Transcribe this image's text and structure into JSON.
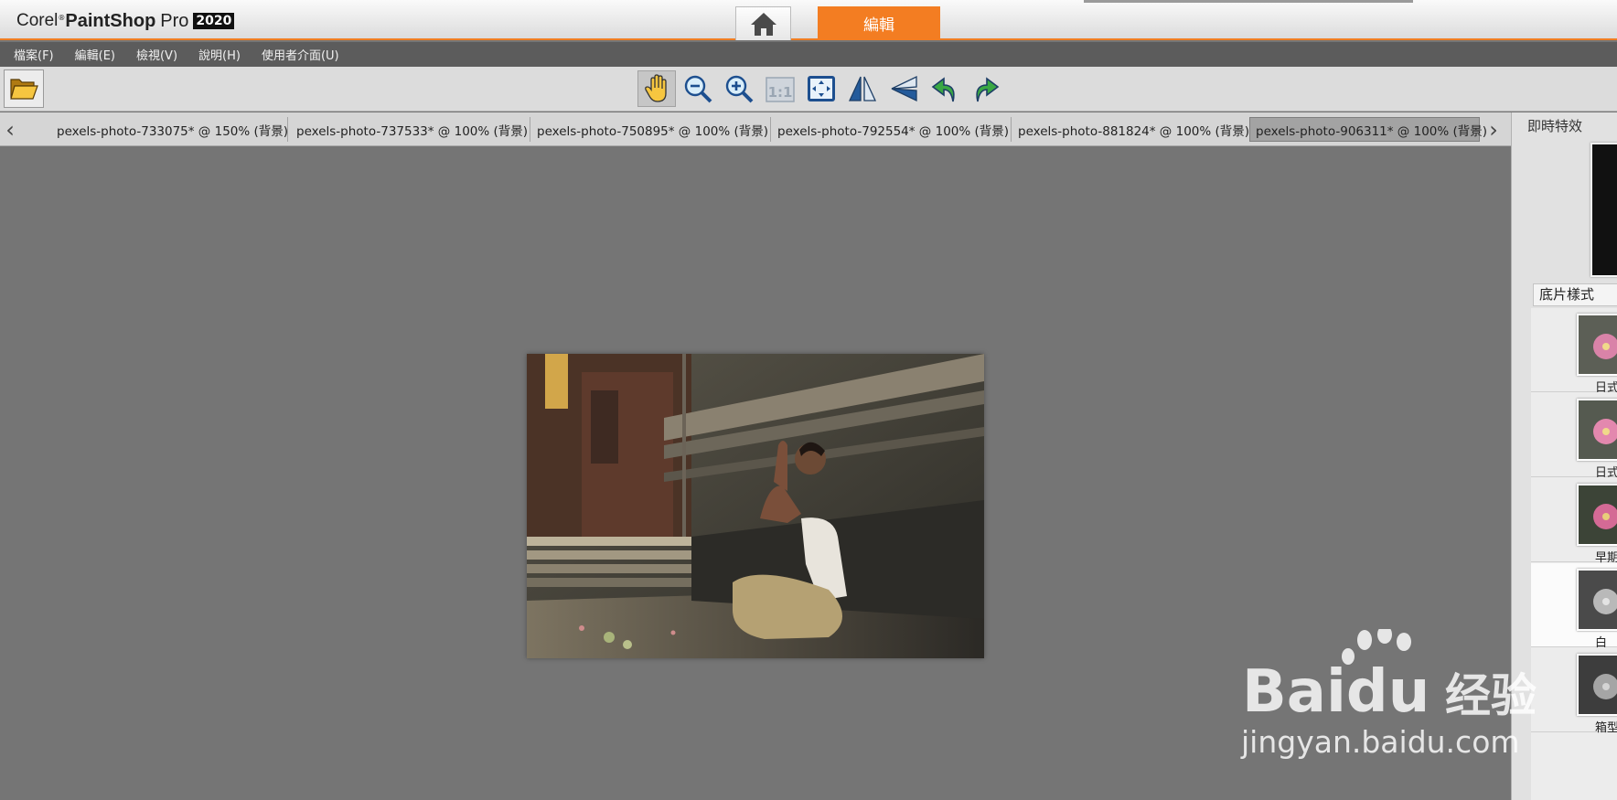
{
  "app": {
    "brand": "Corel",
    "product": "PaintShop",
    "edition": "Pro",
    "year": "2020"
  },
  "workspace_tabs": {
    "home_icon": "home-icon",
    "edit_label": "編輯"
  },
  "menu": [
    {
      "label": "檔案(F)"
    },
    {
      "label": "編輯(E)"
    },
    {
      "label": "檢視(V)"
    },
    {
      "label": "說明(H)"
    },
    {
      "label": "使用者介面(U)"
    }
  ],
  "toolbar": {
    "open_icon": "folder-open-icon",
    "tools": [
      {
        "icon": "pan-hand-icon",
        "active": true
      },
      {
        "icon": "zoom-out-icon"
      },
      {
        "icon": "zoom-in-icon"
      },
      {
        "icon": "actual-size-icon",
        "label": "1:1",
        "disabled": true
      },
      {
        "icon": "fit-to-window-icon"
      },
      {
        "icon": "flip-horizontal-icon"
      },
      {
        "icon": "flip-vertical-icon"
      },
      {
        "icon": "rotate-left-icon"
      },
      {
        "icon": "rotate-right-icon"
      }
    ]
  },
  "document_tabs": [
    {
      "label": "pexels-photo-733075* @ 150% (背景)"
    },
    {
      "label": "pexels-photo-737533* @ 100% (背景)"
    },
    {
      "label": "pexels-photo-750895* @ 100% (背景)"
    },
    {
      "label": "pexels-photo-792554* @ 100% (背景)"
    },
    {
      "label": "pexels-photo-881824* @ 100% (背景)"
    },
    {
      "label": "pexels-photo-906311* @ 100% (背景)",
      "active": true
    }
  ],
  "panel": {
    "title": "即時特效",
    "style_select": "底片樣式",
    "presets": [
      {
        "label": "日式"
      },
      {
        "label": "日式"
      },
      {
        "label": "早期"
      },
      {
        "label": "白",
        "selected": true
      },
      {
        "label": "箱型"
      }
    ]
  },
  "watermark": {
    "brand": "Baidu",
    "suffix": "经验",
    "url": "jingyan.baidu.com"
  },
  "colors": {
    "accent": "#f37d22",
    "canvas": "#757575",
    "menubar": "#5c5c5c",
    "toolbar": "#dcdcdc"
  }
}
